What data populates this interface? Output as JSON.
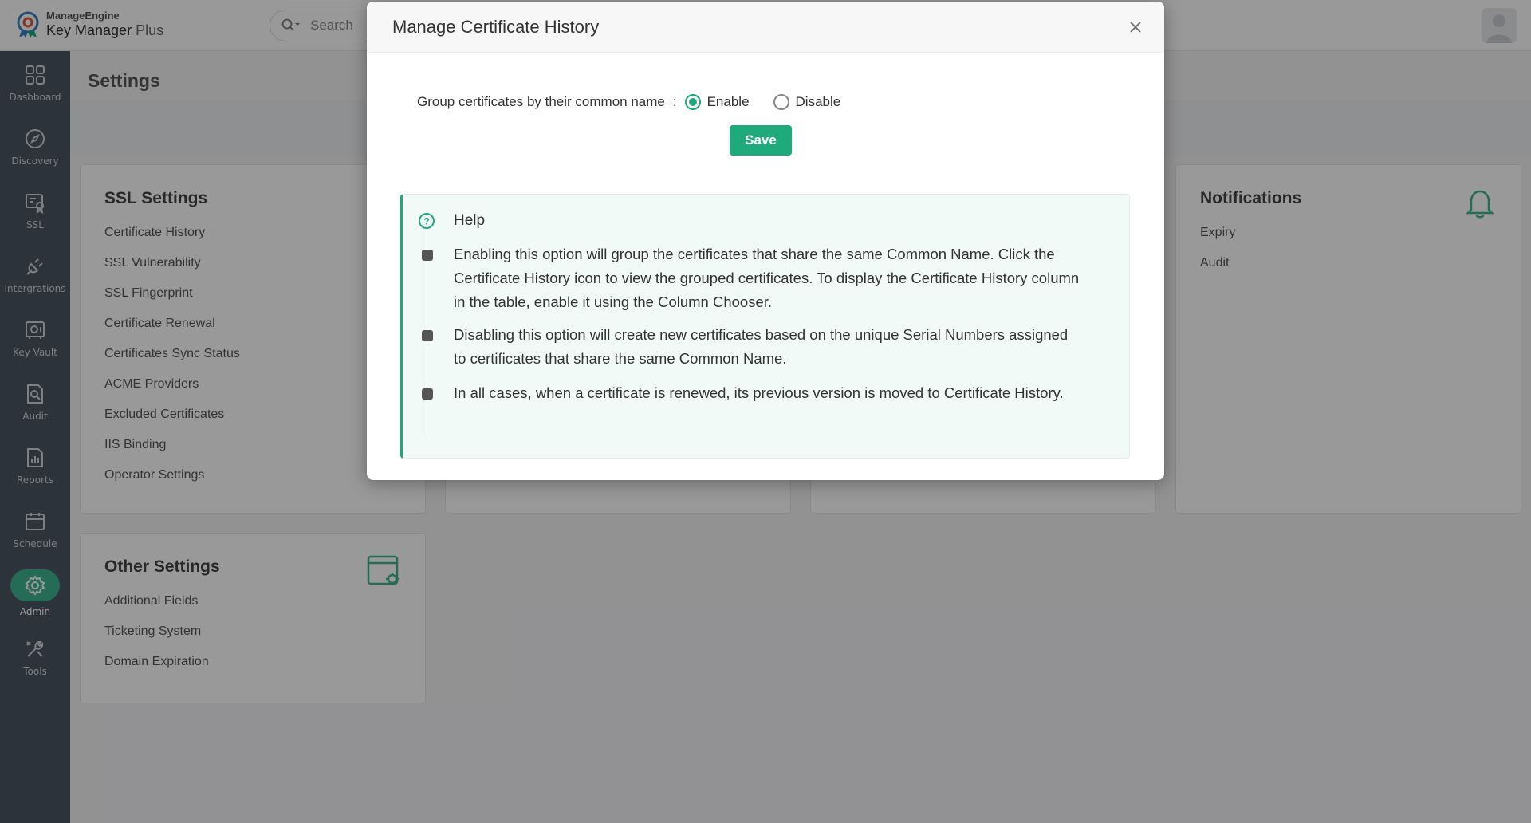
{
  "header": {
    "brand_top": "ManageEngine",
    "brand_main": "Key Manager",
    "brand_plus": "Plus",
    "search_placeholder": "Search"
  },
  "sidebar": {
    "items": [
      {
        "label": "Dashboard",
        "icon": "dashboard-icon"
      },
      {
        "label": "Discovery",
        "icon": "compass-icon"
      },
      {
        "label": "SSL",
        "icon": "certificate-icon"
      },
      {
        "label": "Intergrations",
        "icon": "plug-icon"
      },
      {
        "label": "Key Vault",
        "icon": "vault-icon"
      },
      {
        "label": "Audit",
        "icon": "audit-icon"
      },
      {
        "label": "Reports",
        "icon": "reports-icon"
      },
      {
        "label": "Schedule",
        "icon": "calendar-icon"
      },
      {
        "label": "Admin",
        "icon": "gear-icon"
      },
      {
        "label": "Tools",
        "icon": "tools-icon"
      }
    ],
    "active": "Admin"
  },
  "main": {
    "title": "Settings",
    "ssl_settings": {
      "title": "SSL Settings",
      "items": [
        "Certificate History",
        "SSL Vulnerability",
        "SSL Fingerprint",
        "Certificate Renewal",
        "Certificates Sync Status",
        "ACME Providers",
        "Excluded Certificates",
        "IIS Binding",
        "Operator Settings"
      ]
    },
    "notifications": {
      "title": "Notifications",
      "items": [
        "Expiry",
        "Audit"
      ]
    },
    "other_settings": {
      "title": "Other Settings",
      "items": [
        "Additional Fields",
        "Ticketing System",
        "Domain Expiration"
      ]
    }
  },
  "modal": {
    "title": "Manage Certificate History",
    "group_label": "Group certificates by their common name",
    "group_sep": ":",
    "enable_label": "Enable",
    "disable_label": "Disable",
    "selected": "Enable",
    "save_label": "Save",
    "help": {
      "title": "Help",
      "items": [
        "Enabling this option will group the certificates that share the same Common Name. Click the Certificate History icon to view the grouped certificates. To display the Certificate History column in the table, enable it using the Column Chooser.",
        "Disabling this option will create new certificates based on the unique Serial Numbers assigned to certificates that share the same Common Name.",
        "In all cases, when a certificate is renewed, its previous version is moved to Certificate History."
      ]
    }
  },
  "colors": {
    "accent": "#1faa7b",
    "sidebar_bg": "#4b5563",
    "help_bg": "#f2faf8"
  }
}
